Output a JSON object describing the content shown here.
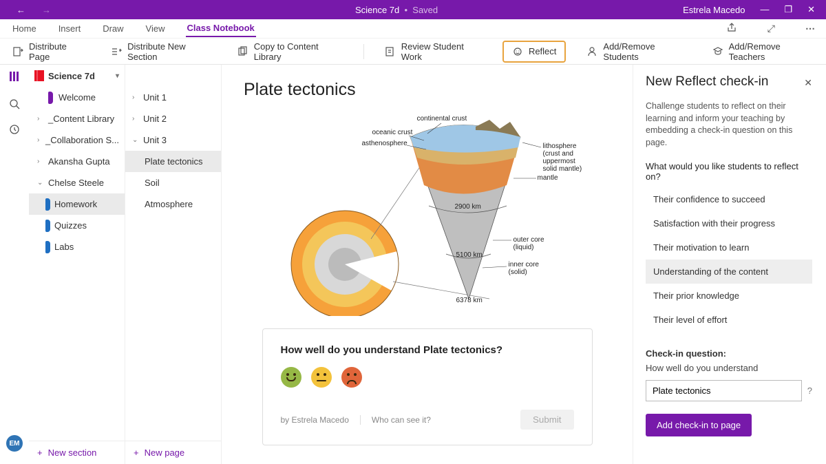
{
  "titlebar": {
    "doc_name": "Science 7d",
    "saved_label": "Saved",
    "user": "Estrela Macedo"
  },
  "ribbon_tabs": [
    "Home",
    "Insert",
    "Draw",
    "View",
    "Class Notebook"
  ],
  "ribbon_active_index": 4,
  "ribbon_cmds": {
    "distribute_page": "Distribute Page",
    "distribute_section": "Distribute New Section",
    "copy_lib": "Copy to Content Library",
    "review": "Review Student Work",
    "reflect": "Reflect",
    "add_students": "Add/Remove Students",
    "add_teachers": "Add/Remove Teachers"
  },
  "rail_avatar_initials": "EM",
  "notebook": {
    "title": "Science 7d",
    "tree": {
      "welcome": "Welcome",
      "content_library": "_Content Library",
      "collab": "_Collaboration S...",
      "student_a": "Akansha Gupta",
      "student_b": "Chelse Steele",
      "subs": {
        "homework": "Homework",
        "quizzes": "Quizzes",
        "labs": "Labs"
      }
    },
    "new_section": "New section"
  },
  "sections": {
    "items": {
      "unit1": "Unit 1",
      "unit2": "Unit 2",
      "unit3": "Unit 3",
      "plate": "Plate tectonics",
      "soil": "Soil",
      "atmo": "Atmosphere"
    },
    "new_page": "New page"
  },
  "page": {
    "title": "Plate tectonics",
    "diagram_labels": {
      "continental_crust": "continental crust",
      "oceanic_crust": "oceanic crust",
      "asthenosphere": "asthenosphere",
      "lithosphere_a": "lithosphere",
      "lithosphere_b": "(crust and uppermost",
      "lithosphere_c": "solid mantle)",
      "mantle": "mantle",
      "depth1": "2900 km",
      "outer_core_a": "outer core",
      "outer_core_b": "(liquid)",
      "depth2": "5100 km",
      "inner_core_a": "inner core",
      "inner_core_b": "(solid)",
      "depth3": "6378 km"
    },
    "checkin": {
      "question": "How well do you understand Plate tectonics?",
      "author_prefix": "by ",
      "author": "Estrela Macedo",
      "visibility": "Who can see it?",
      "submit": "Submit"
    }
  },
  "panel": {
    "title": "New Reflect check-in",
    "desc": "Challenge students to reflect on their learning and inform your teaching by embedding a check-in question on this page.",
    "prompt": "What would you like students to reflect on?",
    "options": [
      "Their confidence to succeed",
      "Satisfaction with their progress",
      "Their motivation to learn",
      "Understanding of the content",
      "Their prior knowledge",
      "Their level of effort"
    ],
    "hover_index": 3,
    "q_label": "Check-in question:",
    "q_sub": "How well do you understand",
    "q_value": "Plate tectonics",
    "add_btn": "Add check-in to page"
  }
}
